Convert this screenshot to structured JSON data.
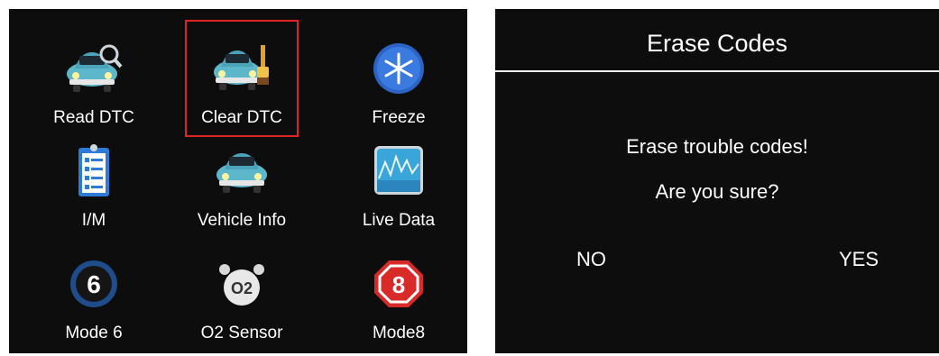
{
  "menu": {
    "items": [
      {
        "label": "Read DTC"
      },
      {
        "label": "Clear DTC"
      },
      {
        "label": "Freeze"
      },
      {
        "label": "I/M"
      },
      {
        "label": "Vehicle Info"
      },
      {
        "label": "Live Data"
      },
      {
        "label": "Mode 6"
      },
      {
        "label": "O2 Sensor"
      },
      {
        "label": "Mode8"
      }
    ],
    "icons": {
      "mode6_number": "6",
      "o2_text": "O2",
      "mode8_number": "8"
    },
    "selected_item": "Clear DTC",
    "accent_color": "#e02525"
  },
  "dialog": {
    "title": "Erase Codes",
    "message_line1": "Erase trouble codes!",
    "message_line2": "Are you sure?",
    "no_label": "NO",
    "yes_label": "YES"
  }
}
